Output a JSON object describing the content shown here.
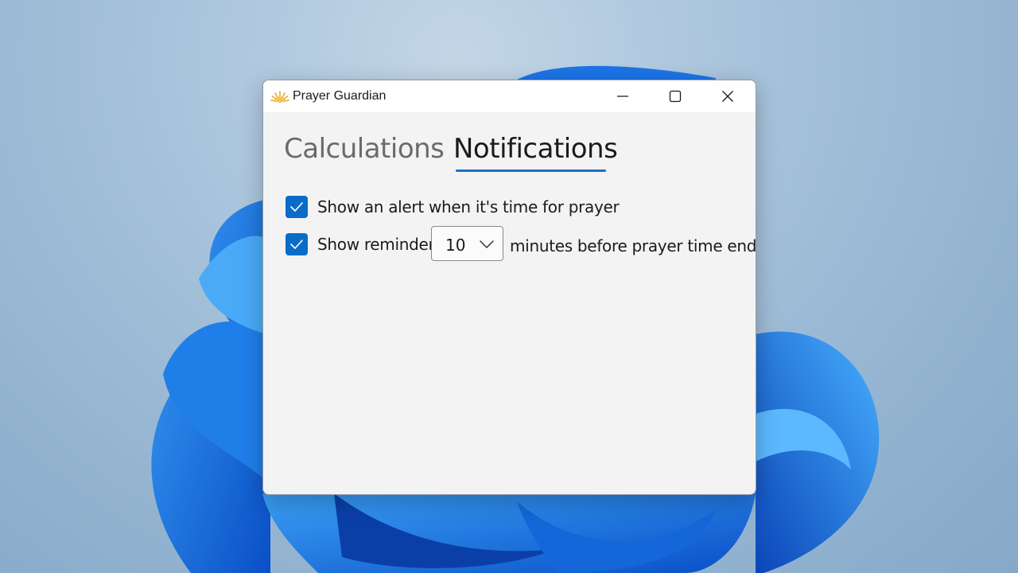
{
  "window": {
    "title": "Prayer Guardian",
    "icon": "sun-rays-icon",
    "controls": {
      "minimize": "minimize-icon",
      "maximize": "maximize-icon",
      "close": "close-icon"
    }
  },
  "tabs": [
    {
      "label": "Calculations",
      "selected": false
    },
    {
      "label": "Notifications",
      "selected": true
    }
  ],
  "notifications": {
    "alert_checkbox": {
      "checked": true,
      "label": "Show an alert when it's time for prayer"
    },
    "reminder_checkbox": {
      "checked": true,
      "label": "Show reminder"
    },
    "reminder_minutes": {
      "value": "10"
    },
    "reminder_suffix": "minutes before prayer time ends"
  },
  "colors": {
    "accent": "#0a6cc9",
    "tab_underline": "#1d6fc4",
    "window_bg": "#f3f3f3",
    "titlebar_bg": "#ffffff"
  }
}
